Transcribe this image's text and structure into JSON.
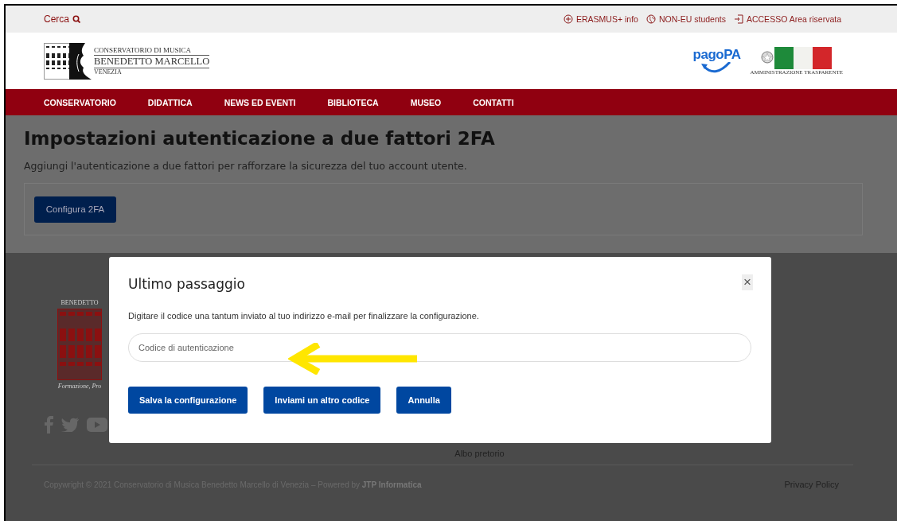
{
  "top_bar": {
    "search_label": "Cerca",
    "links": [
      {
        "kind": "plus",
        "label": "ERASMUS+ info"
      },
      {
        "kind": "globe",
        "label": "NON-EU students"
      },
      {
        "kind": "login",
        "label": "ACCESSO Area riservata"
      }
    ]
  },
  "header": {
    "logo": {
      "line1": "CONSERVATORIO DI MUSICA",
      "line2": "BENEDETTO MARCELLO",
      "line3": "VENEZIA"
    },
    "pagopa": "pagoPA",
    "transparency": "AMMINISTRAZIONE TRASPARENTE"
  },
  "nav": [
    {
      "label": "CONSERVATORIO"
    },
    {
      "label": "DIDATTICA"
    },
    {
      "label": "NEWS ED EVENTI"
    },
    {
      "label": "BIBLIOTECA"
    },
    {
      "label": "MUSEO"
    },
    {
      "label": "CONTATTI"
    }
  ],
  "page": {
    "title": "Impostazioni autenticazione a due fattori 2FA",
    "subtitle": "Aggiungi l'autenticazione a due fattori per rafforzare la sicurezza del tuo account utente.",
    "button": "Configura 2FA"
  },
  "footer": {
    "logo_text": "BENEDETTO",
    "tagline": "Formazione, Pro",
    "link": "Albo pretorio",
    "copyright": "Copywright © 2021 Conservatorio di Musica Benedetto Marcello di Venezia – Powered by **JTP Informatica**",
    "privacy": "Privacy Policy"
  },
  "modal": {
    "title": "Ultimo passaggio",
    "close": "×",
    "text": "Digitare il codice una tantum inviato al tuo indirizzo e-mail per finalizzare la configurazione.",
    "input": {
      "placeholder": "Codice di autenticazione"
    },
    "buttons": [
      {
        "label": "Salva la configurazione"
      },
      {
        "label": "Inviami un altro codice"
      },
      {
        "label": "Annulla"
      }
    ]
  }
}
